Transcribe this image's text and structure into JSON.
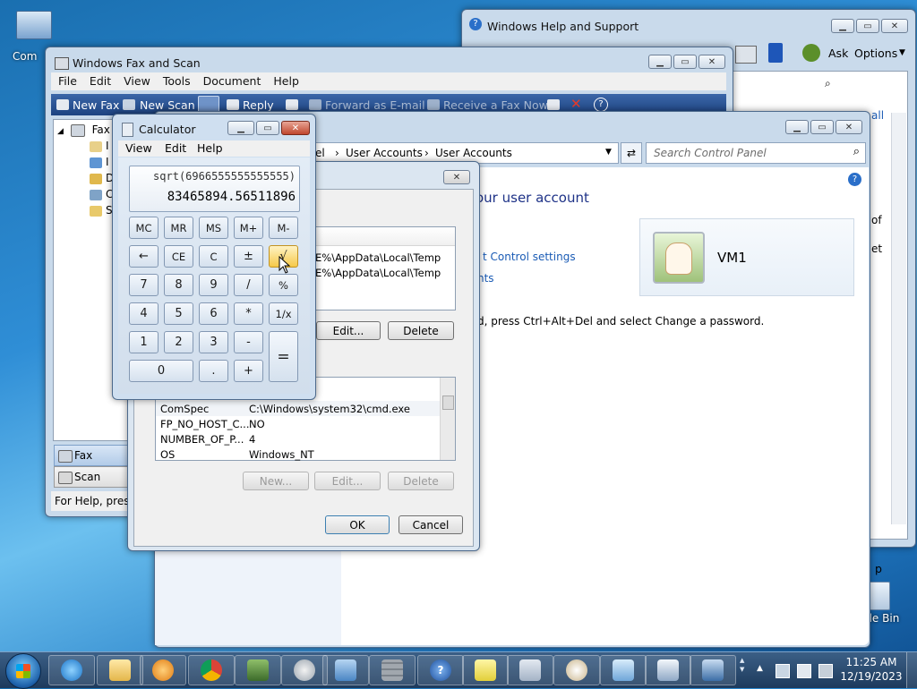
{
  "desktop": {
    "computer_label": "Com",
    "recycle_label": "cle Bin"
  },
  "help_window": {
    "title": "Windows Help and Support",
    "ask": "Ask",
    "options": "Options",
    "side_link1": "all",
    "side_text1": "of",
    "side_text2": "et",
    "side_menu": "p"
  },
  "fax_window": {
    "title": "Windows Fax and Scan",
    "menu": [
      "File",
      "Edit",
      "View",
      "Tools",
      "Document",
      "Help"
    ],
    "toolbar": {
      "new_fax": "New Fax",
      "new_scan": "New Scan",
      "reply": "Reply",
      "forward": "Forward as E-mail",
      "receive": "Receive a Fax Now"
    },
    "tree": {
      "root": "Fax",
      "items": [
        "I",
        "I",
        "D",
        "C",
        "S"
      ]
    },
    "nav": {
      "fax": "Fax",
      "scan": "Scan"
    },
    "status": "For Help, press"
  },
  "control_panel": {
    "breadcrumb": [
      "el",
      "User Accounts",
      "User Accounts"
    ],
    "search_placeholder": "Search Control Panel",
    "heading": "our user account",
    "links": [
      "t Control settings",
      "nts"
    ],
    "user_name": "VM1",
    "password_note": "d, press Ctrl+Alt+Del and select Change a password."
  },
  "env_dialog": {
    "user_rows": [
      {
        "value": "E%\\AppData\\Local\\Temp"
      },
      {
        "value": "E%\\AppData\\Local\\Temp"
      }
    ],
    "user_buttons": {
      "edit": "Edit...",
      "delete": "Delete"
    },
    "system_rows": [
      {
        "name": "ComSpec",
        "value": "C:\\Windows\\system32\\cmd.exe"
      },
      {
        "name": "FP_NO_HOST_C...",
        "value": "NO"
      },
      {
        "name": "NUMBER_OF_P...",
        "value": "4"
      },
      {
        "name": "OS",
        "value": "Windows_NT"
      }
    ],
    "system_buttons": {
      "new": "New...",
      "edit": "Edit...",
      "delete": "Delete"
    },
    "ok": "OK",
    "cancel": "Cancel"
  },
  "calculator": {
    "title": "Calculator",
    "menu": [
      "View",
      "Edit",
      "Help"
    ],
    "expression": "sqrt(6966555555555555)",
    "result": "83465894.56511896",
    "mem_keys": [
      "MC",
      "MR",
      "MS",
      "M+",
      "M-"
    ],
    "row1": [
      "←",
      "CE",
      "C",
      "±",
      "√"
    ],
    "row2": [
      "7",
      "8",
      "9",
      "/",
      "%"
    ],
    "row3": [
      "4",
      "5",
      "6",
      "*",
      "1/x"
    ],
    "row4": [
      "1",
      "2",
      "3",
      "-"
    ],
    "row5": [
      "0",
      ".",
      "+"
    ],
    "equals": "="
  },
  "taskbar": {
    "time": "11:25 AM",
    "date": "12/19/2023",
    "tray_arrow": "▲"
  }
}
